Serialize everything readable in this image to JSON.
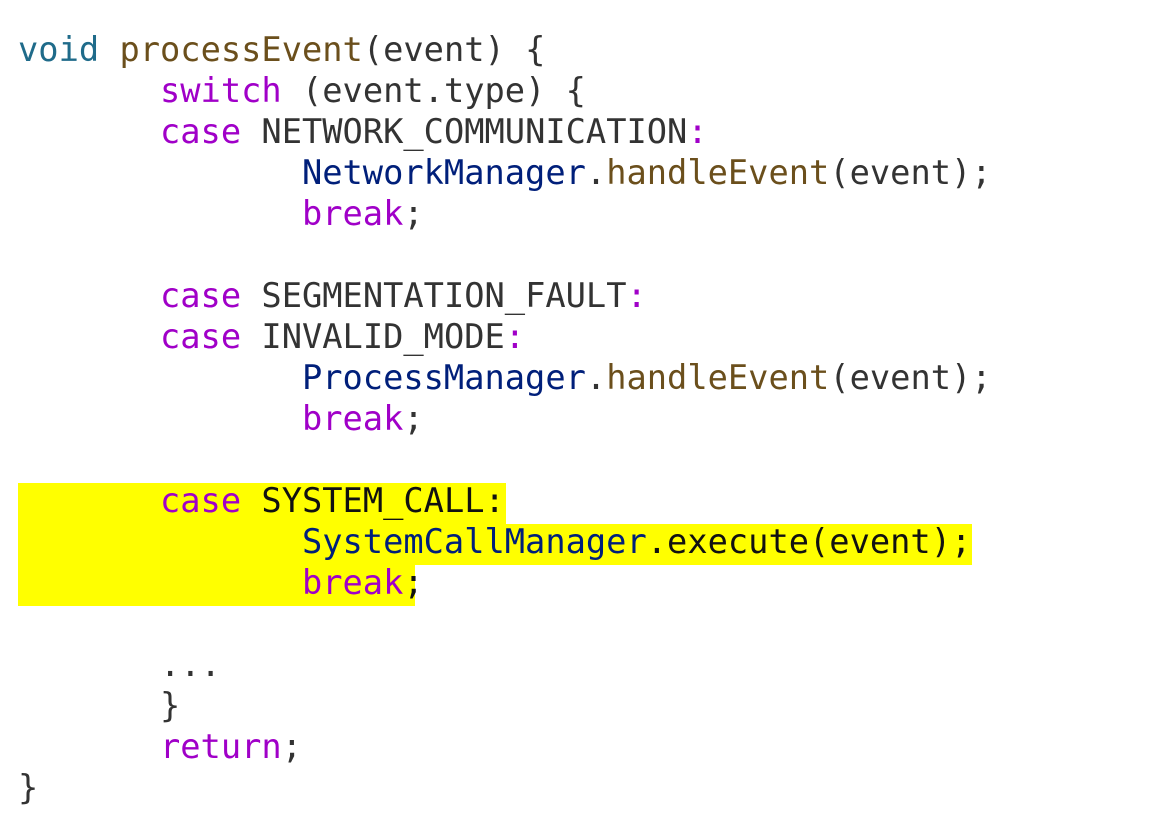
{
  "code": {
    "l1": {
      "kw": "void",
      "fn": "processEvent",
      "rest": "(event) {"
    },
    "l2": {
      "kw": "switch",
      "rest": " (event.type) {"
    },
    "l3": {
      "kw": "case",
      "label": " NETWORK_COMMUNICATION",
      "colon": ":"
    },
    "l4": {
      "cls": "NetworkManager",
      "dot": ".",
      "fn": "handleEvent",
      "rest": "(event);"
    },
    "l5": {
      "kw": "break",
      "semi": ";"
    },
    "l7": {
      "kw": "case",
      "label": " SEGMENTATION_FAULT",
      "colon": ":"
    },
    "l8": {
      "kw": "case",
      "label": " INVALID_MODE",
      "colon": ":"
    },
    "l9": {
      "cls": "ProcessManager",
      "dot": ".",
      "fn": "handleEvent",
      "rest": "(event);"
    },
    "l10": {
      "kw": "break",
      "semi": ";"
    },
    "l12": {
      "kw": "case",
      "label": " SYSTEM_CALL:"
    },
    "l13": {
      "cls": "SystemCallManager",
      "rest": ".execute(event);"
    },
    "l14": {
      "kw": "break",
      "semi": ";"
    },
    "l16": {
      "text": "..."
    },
    "l17": {
      "text": "}"
    },
    "l18": {
      "kw": "return",
      "semi": ";"
    },
    "l19": {
      "text": "}"
    }
  },
  "colors": {
    "highlight": "#ffff00",
    "keyword": "#a000c8",
    "type_keyword": "#1f6b8a",
    "function": "#6b4f1c",
    "class": "#001f7a"
  }
}
